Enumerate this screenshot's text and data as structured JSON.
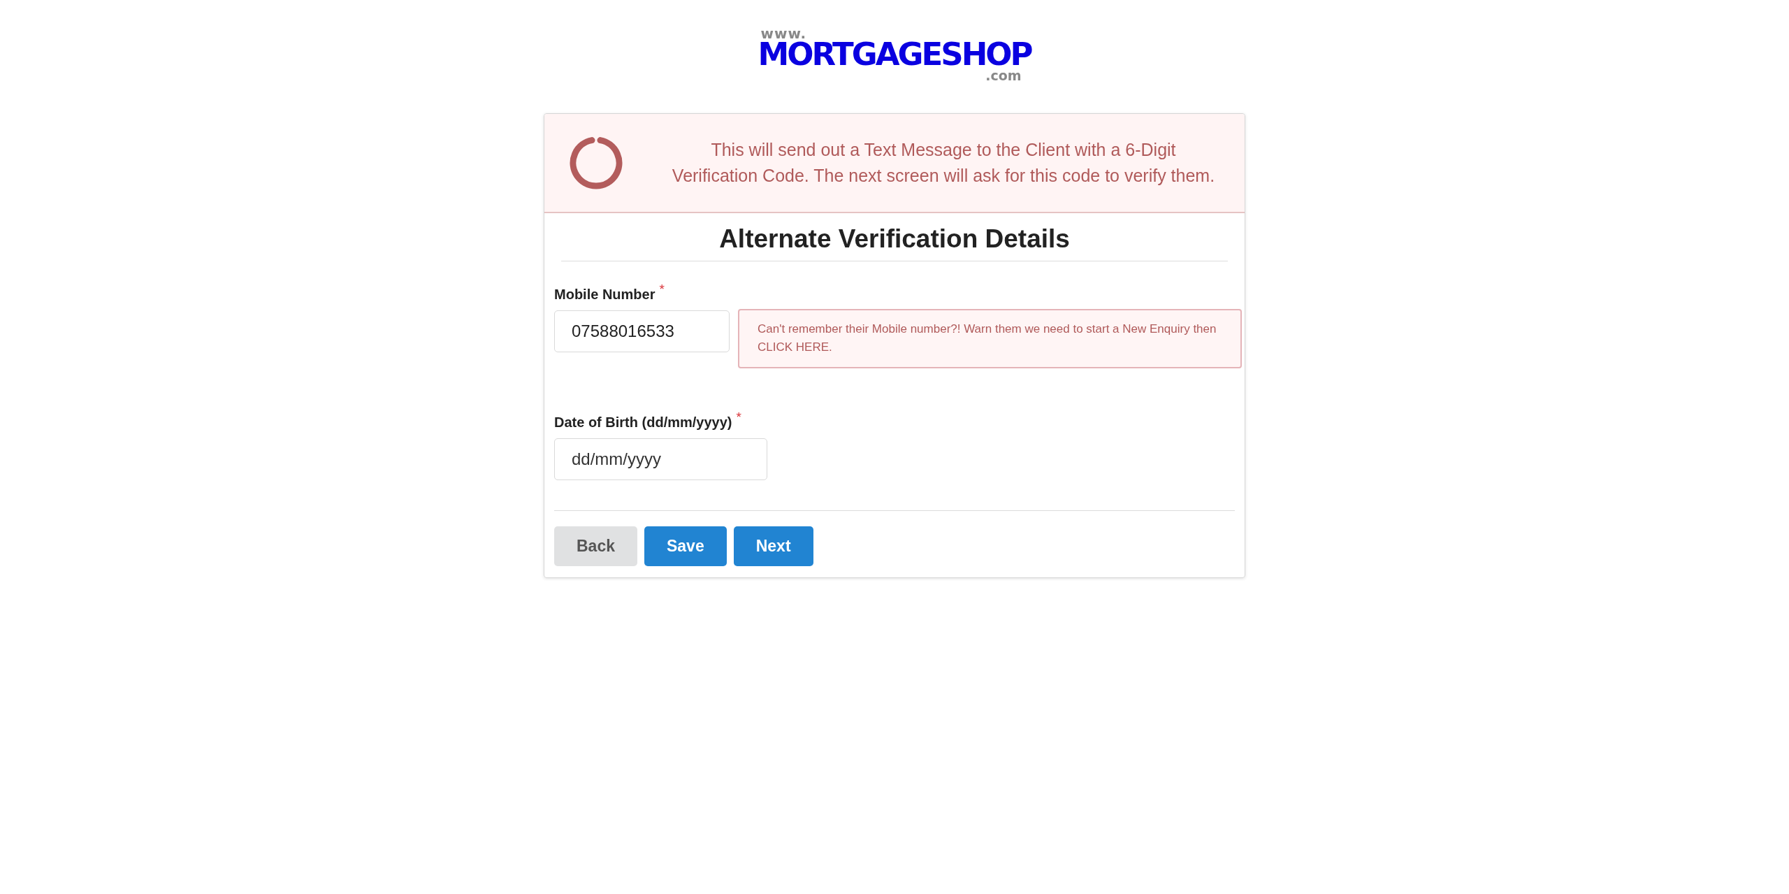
{
  "logo": {
    "prefix": "www.",
    "name": "MORTGAGESHOP",
    "suffix": ".com"
  },
  "notice": {
    "text": "This will send out a Text Message to the Client with a 6-Digit Verification Code. The next screen will ask for this code to verify them."
  },
  "heading": "Alternate Verification Details",
  "fields": [
    {
      "label": "Mobile Number",
      "required_mark": "*",
      "value": "07588016533",
      "hint": "Can't remember their Mobile number?! Warn them we need to start a New Enquiry then CLICK HERE."
    },
    {
      "label": "Date of Birth (dd/mm/yyyy)",
      "required_mark": "*",
      "placeholder": "dd/mm/yyyy"
    }
  ],
  "buttons": [
    {
      "label": "Back",
      "kind": "secondary"
    },
    {
      "label": "Save",
      "kind": "primary"
    },
    {
      "label": "Next",
      "kind": "primary"
    }
  ]
}
